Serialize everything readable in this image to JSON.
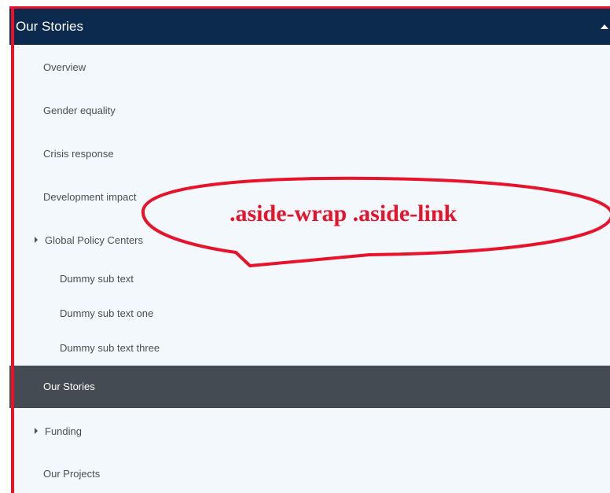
{
  "panel": {
    "title": "Our Stories",
    "colors": {
      "header_bg": "#0c2a4d",
      "body_bg": "#f3f8fc",
      "active_bg": "#454b52",
      "annotation": "#e8132a"
    }
  },
  "nav": {
    "items": [
      {
        "label": "Overview"
      },
      {
        "label": "Gender equality"
      },
      {
        "label": "Crisis response"
      },
      {
        "label": "Development impact"
      },
      {
        "label": "Global Policy Centers",
        "icon": "caret-right-icon"
      },
      {
        "label": "Dummy sub text"
      },
      {
        "label": "Dummy sub text one"
      },
      {
        "label": "Dummy sub text three"
      },
      {
        "label": "Our Stories",
        "active": true
      },
      {
        "label": "Funding",
        "icon": "caret-right-icon"
      },
      {
        "label": "Our Projects"
      }
    ]
  },
  "annotation": {
    "text": ".aside-wrap .aside-link"
  }
}
